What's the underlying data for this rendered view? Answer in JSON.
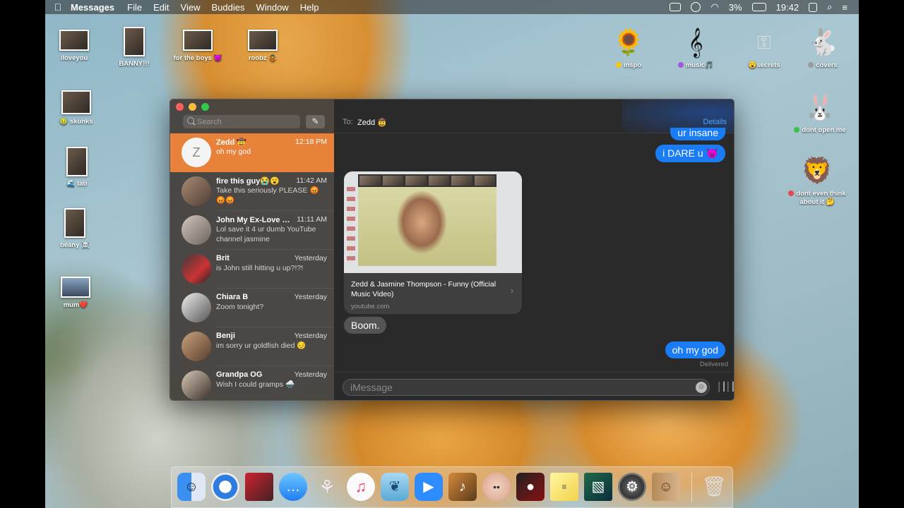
{
  "menubar": {
    "app_name": "Messages",
    "menus": [
      "File",
      "Edit",
      "View",
      "Buddies",
      "Window",
      "Help"
    ],
    "battery": "3%",
    "clock": "19:42"
  },
  "desktop_icons": {
    "iloveyou": "iloveyou",
    "banny": "BANNY!!!",
    "forboys": "for the boys 😈",
    "roobz": "roobz 🤹",
    "skunks": "🤢 skunks",
    "tati": "🌊 tati",
    "beany": "beany ☠️",
    "mum": "mum❤️",
    "inspo": "inspo",
    "music": "music🎵",
    "secrets": "😮secrets",
    "covers": "covers",
    "dontopen": "dont open me",
    "donteven": "dont even think about it 🤔"
  },
  "sidebar": {
    "search_placeholder": "Search",
    "conversations": [
      {
        "name": "Zedd 🤠",
        "time": "12:18 PM",
        "preview": "oh my god",
        "initial": "Z"
      },
      {
        "name": "fire this guy😭😮",
        "time": "11:42 AM",
        "preview": "Take this seriously PLEASE 😡😡😡"
      },
      {
        "name": "John My Ex-Love 🤢...",
        "time": "11:11 AM",
        "preview": "Lol save it 4 ur dumb YouTube channel jasmine"
      },
      {
        "name": "Brit",
        "time": "Yesterday",
        "preview": "is John still hitting u up?!?!"
      },
      {
        "name": "Chiara B",
        "time": "Yesterday",
        "preview": "Zoom tonight?"
      },
      {
        "name": "Benji",
        "time": "Yesterday",
        "preview": "im sorry ur goldfish died 😔"
      },
      {
        "name": "Grandpa OG",
        "time": "Yesterday",
        "preview": "Wish I could gramps 🌧️"
      }
    ]
  },
  "chat": {
    "to_label": "To:",
    "to_name": "Zedd 🤠",
    "details": "Details",
    "msg_partial": "ur insane",
    "msg_dare": "i DARE u 😈",
    "link_title": "Zedd & Jasmine Thompson - Funny (Official Music Video)",
    "link_domain": "youtube.com",
    "msg_boom": "Boom.",
    "msg_omg": "oh my god",
    "delivered": "Delivered",
    "input_placeholder": "iMessage"
  }
}
